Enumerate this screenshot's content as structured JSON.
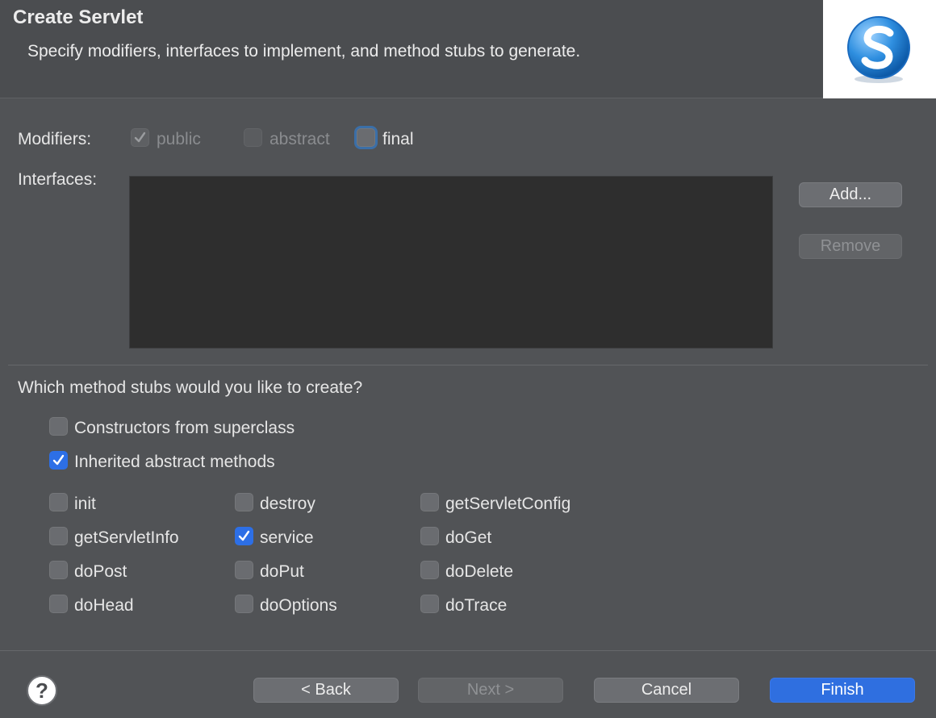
{
  "header": {
    "title": "Create Servlet",
    "description": "Specify modifiers, interfaces to implement, and method stubs to generate."
  },
  "modifiers": {
    "label": "Modifiers:",
    "public": {
      "label": "public",
      "checked": true,
      "enabled": false
    },
    "abstract": {
      "label": "abstract",
      "checked": false,
      "enabled": false
    },
    "final": {
      "label": "final",
      "checked": false,
      "enabled": true
    }
  },
  "interfaces": {
    "label": "Interfaces:",
    "items": [],
    "add_label": "Add...",
    "remove_label": "Remove"
  },
  "stubs": {
    "question": "Which method stubs would you like to create?",
    "constructors": {
      "label": "Constructors from superclass",
      "checked": false
    },
    "inherited": {
      "label": "Inherited abstract methods",
      "checked": true
    },
    "methods": [
      {
        "label": "init",
        "checked": false
      },
      {
        "label": "destroy",
        "checked": false
      },
      {
        "label": "getServletConfig",
        "checked": false
      },
      {
        "label": "getServletInfo",
        "checked": false
      },
      {
        "label": "service",
        "checked": true
      },
      {
        "label": "doGet",
        "checked": false
      },
      {
        "label": "doPost",
        "checked": false
      },
      {
        "label": "doPut",
        "checked": false
      },
      {
        "label": "doDelete",
        "checked": false
      },
      {
        "label": "doHead",
        "checked": false
      },
      {
        "label": "doOptions",
        "checked": false
      },
      {
        "label": "doTrace",
        "checked": false
      }
    ]
  },
  "footer": {
    "help_icon": "?",
    "back_label": "< Back",
    "next_label": "Next >",
    "cancel_label": "Cancel",
    "finish_label": "Finish"
  },
  "colors": {
    "accent": "#2f6fe0",
    "background": "#515356"
  }
}
